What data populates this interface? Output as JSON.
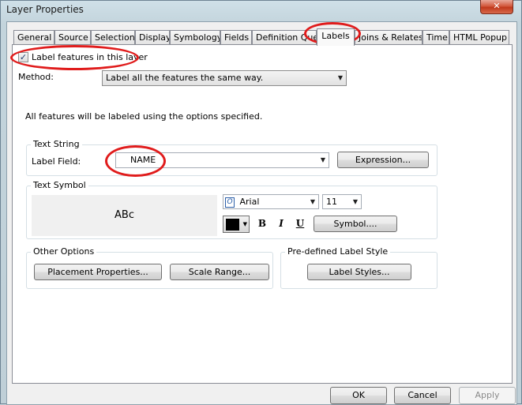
{
  "window": {
    "title": "Layer Properties",
    "close_symbol": "✕"
  },
  "tabs": [
    {
      "label": "General"
    },
    {
      "label": "Source"
    },
    {
      "label": "Selection"
    },
    {
      "label": "Display"
    },
    {
      "label": "Symbology"
    },
    {
      "label": "Fields"
    },
    {
      "label": "Definition Query"
    },
    {
      "label": "Labels"
    },
    {
      "label": "Joins & Relates"
    },
    {
      "label": "Time"
    },
    {
      "label": "HTML Popup"
    }
  ],
  "labels": {
    "label_features_checkbox": {
      "label": "Label features in this layer",
      "checked": true,
      "mark": "✓"
    },
    "method": {
      "label": "Method:",
      "value": "Label all the features the same way."
    },
    "info_text": "All features will be labeled using the options specified.",
    "text_string": {
      "group_label": "Text String",
      "field_label": "Label Field:",
      "field_value": "NAME",
      "expression_button": "Expression..."
    },
    "text_symbol": {
      "group_label": "Text Symbol",
      "preview_text": "ABc",
      "font_glyph": "O",
      "font": "Arial",
      "size": "11",
      "bold": "B",
      "italic": "I",
      "underline": "U",
      "symbol_button": "Symbol...."
    },
    "other_options": {
      "group_label": "Other Options",
      "placement_button": "Placement Properties...",
      "scale_button": "Scale Range..."
    },
    "predefined": {
      "group_label": "Pre-defined Label Style",
      "label_styles_button": "Label Styles..."
    }
  },
  "footer": {
    "ok": "OK",
    "cancel": "Cancel",
    "apply": "Apply"
  },
  "colors": {
    "highlight": "#e01c1c",
    "text_color": "#000000"
  }
}
